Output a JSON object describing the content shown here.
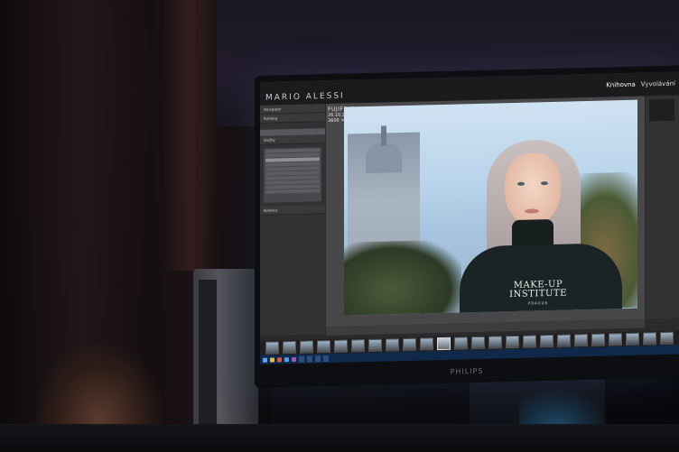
{
  "lightroom": {
    "brand": "MARIO ALESSI",
    "modules": [
      "Knihovna",
      "Vyvolávání"
    ],
    "active_module": "Knihovna",
    "photo_info": {
      "camera": "FUJIFILM",
      "date": "26.10.2018",
      "size": "3600 × 5400"
    },
    "left_panel": {
      "sections": [
        "Navigator",
        "Katalog",
        "Složky",
        "Kolekce"
      ]
    },
    "filmstrip_thumbnails": 24
  },
  "photo": {
    "shirt_line1": "MAKE-UP",
    "shirt_line2": "INSTITUTE",
    "shirt_line3": "PRAGUE"
  },
  "monitor": {
    "brand": "PHILIPS"
  },
  "colors": {
    "screen_bg": "#2b2b2d",
    "panel": "#323234",
    "taskbar": "#10284a",
    "ambient_glow": "#3c5a8c"
  }
}
